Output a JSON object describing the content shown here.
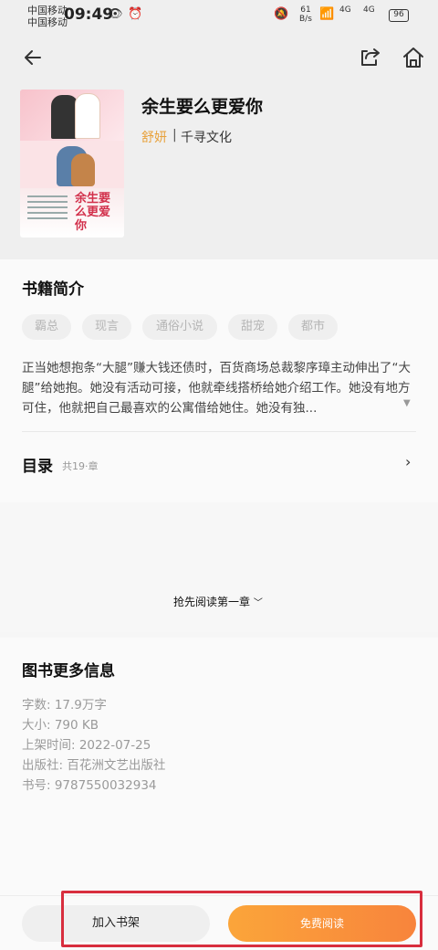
{
  "status_bar": {
    "carrier1": "中国移动",
    "carrier2": "中国移动",
    "time": "09:49",
    "net_speed_value": "61",
    "net_speed_unit": "B/s",
    "signal1": "4G",
    "signal2": "4G",
    "battery": "96"
  },
  "book": {
    "title": "余生要么更爱你",
    "author": "舒妍",
    "separator": "|",
    "publisher": "千寻文化",
    "cover_title": "余生要么更爱你"
  },
  "intro_section": {
    "title": "书籍简介",
    "tags": [
      "霸总",
      "现言",
      "通俗小说",
      "甜宠",
      "都市"
    ],
    "text": "正当她想抱条“大腿”赚大钱还债时，百货商场总裁黎序璋主动伸出了“大腿”给她抱。她没有活动可接，他就牵线搭桥给她介绍工作。她没有地方可住，他就把自己最喜欢的公寓借给她住。她没有独..."
  },
  "toc": {
    "label": "目录",
    "count": "共19·章"
  },
  "preview": {
    "link_text": "抢先阅读第一章"
  },
  "more_info": {
    "title": "图书更多信息",
    "rows": [
      "字数:  17.9万字",
      "大小:  790 KB",
      "上架时间:  2022-07-25",
      "出版社:  百花洲文艺出版社",
      "书号:  9787550032934"
    ]
  },
  "bottom_bar": {
    "add_shelf": "加入书架",
    "free_read": "免费阅读"
  },
  "colors": {
    "accent_orange": "#f8943a",
    "author_color": "#e8a13a",
    "highlight_red": "#d82e3e"
  }
}
